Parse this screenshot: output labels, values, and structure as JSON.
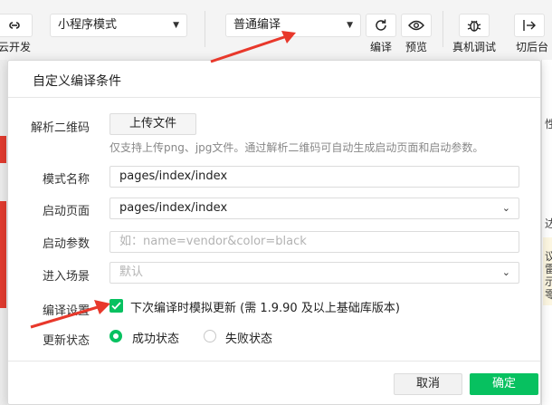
{
  "toolbar": {
    "cloud_label": "云开发",
    "mode_select": "小程序模式",
    "compile_select": "普通编译",
    "compile_label": "编译",
    "preview_label": "预览",
    "remote_debug_label": "真机调试",
    "background_label": "切后台"
  },
  "background": {
    "right_glyphs": [
      "性",
      "达",
      "议",
      "雷",
      "示",
      "零"
    ]
  },
  "dialog": {
    "title": "自定义编译条件",
    "qr_label": "解析二维码",
    "upload_button": "上传文件",
    "qr_hint": "仅支持上传png、jpg文件。通过解析二维码可自动生成启动页面和启动参数。",
    "mode_name_label": "模式名称",
    "mode_name_value": "pages/index/index",
    "start_page_label": "启动页面",
    "start_page_value": "pages/index/index",
    "start_params_label": "启动参数",
    "start_params_placeholder": "如：name=vendor&color=black",
    "scene_label": "进入场景",
    "scene_placeholder": "默认",
    "compile_settings_label": "编译设置",
    "simulate_update_text": "下次编译时模拟更新 (需 1.9.90 及以上基础库版本)",
    "update_state_label": "更新状态",
    "success_state": "成功状态",
    "fail_state": "失败状态",
    "cancel_button": "取消",
    "confirm_button": "确定"
  },
  "colors": {
    "accent_green": "#07c160",
    "arrow_red": "#e8382b"
  }
}
